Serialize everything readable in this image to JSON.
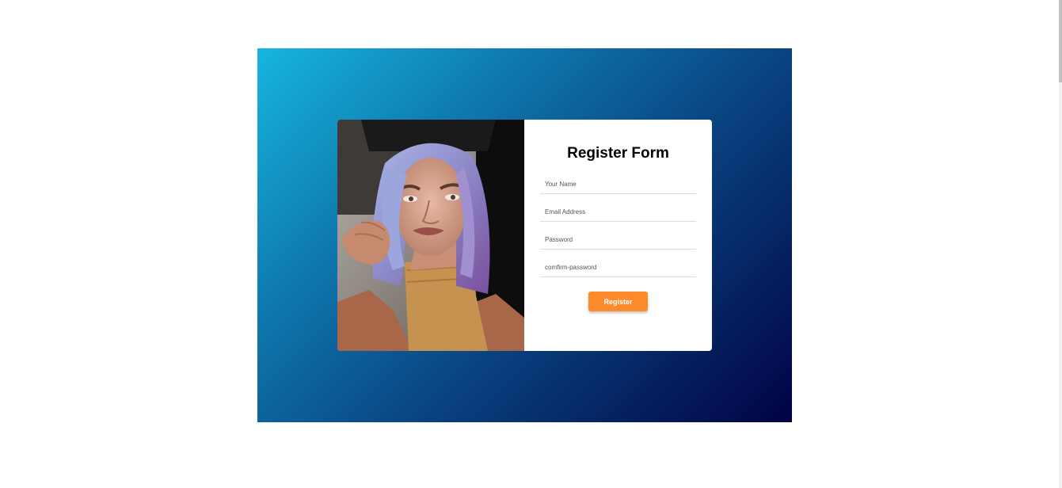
{
  "form": {
    "title": "Register Form",
    "fields": [
      {
        "placeholder": "Your Name",
        "value": ""
      },
      {
        "placeholder": "Email Address",
        "value": ""
      },
      {
        "placeholder": "Password",
        "value": ""
      },
      {
        "placeholder": "comfirm-password",
        "value": ""
      }
    ],
    "submit_label": "Register"
  },
  "colors": {
    "gradient_start": "#17b5e0",
    "gradient_end": "#010244",
    "button": "#fd8a2b",
    "card": "#ffffff"
  },
  "photo": {
    "subject": "woman-with-lavender-hair-portrait"
  }
}
